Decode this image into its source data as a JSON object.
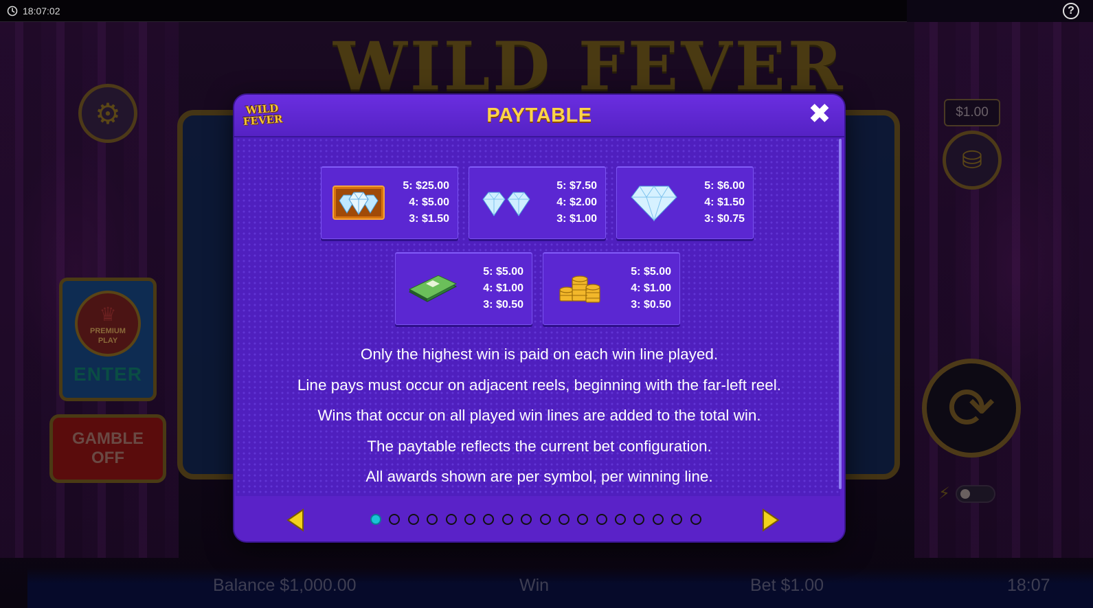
{
  "status_bar": {
    "time": "18:07:02",
    "help_icon": "question-circle-icon"
  },
  "background_game": {
    "logo": "WILD FEVER",
    "bet_display": "$1.00",
    "premium_play": {
      "line1": "PREMIUM",
      "line2": "PLAY",
      "enter_label": "ENTER"
    },
    "gamble": {
      "line1": "GAMBLE",
      "line2": "OFF"
    },
    "bottom_bar": {
      "balance": "Balance $1,000.00",
      "win": "Win",
      "bet": "Bet $1.00",
      "clock": "18:07"
    }
  },
  "paytable": {
    "logo_line1": "WILD",
    "logo_line2": "FEVER",
    "title": "PAYTABLE",
    "close_icon": "close-x-icon",
    "symbols": [
      {
        "name": "framed-triple-diamond",
        "icon": "framed-triple-diamond-icon",
        "pays": [
          {
            "k": "5:",
            "v": "$25.00"
          },
          {
            "k": "4:",
            "v": "$5.00"
          },
          {
            "k": "3:",
            "v": "$1.50"
          }
        ]
      },
      {
        "name": "double-diamond",
        "icon": "double-diamond-icon",
        "pays": [
          {
            "k": "5:",
            "v": "$7.50"
          },
          {
            "k": "4:",
            "v": "$2.00"
          },
          {
            "k": "3:",
            "v": "$1.00"
          }
        ]
      },
      {
        "name": "single-diamond",
        "icon": "diamond-icon",
        "pays": [
          {
            "k": "5:",
            "v": "$6.00"
          },
          {
            "k": "4:",
            "v": "$1.50"
          },
          {
            "k": "3:",
            "v": "$0.75"
          }
        ]
      },
      {
        "name": "cash-stack",
        "icon": "cash-stack-icon",
        "pays": [
          {
            "k": "5:",
            "v": "$5.00"
          },
          {
            "k": "4:",
            "v": "$1.00"
          },
          {
            "k": "3:",
            "v": "$0.50"
          }
        ]
      },
      {
        "name": "gold-coins",
        "icon": "gold-coins-icon",
        "pays": [
          {
            "k": "5:",
            "v": "$5.00"
          },
          {
            "k": "4:",
            "v": "$1.00"
          },
          {
            "k": "3:",
            "v": "$0.50"
          }
        ]
      }
    ],
    "rules": [
      "Only the highest win is paid on each win line played.",
      "Line pays must occur on adjacent reels, beginning with the far-left reel.",
      "Wins that occur on all played win lines are added to the total win.",
      "The paytable reflects the current bet configuration.",
      "All awards shown are per symbol, per winning line."
    ],
    "pagination": {
      "total_pages": 18,
      "current_page": 1,
      "prev_icon": "arrow-left-icon",
      "next_icon": "arrow-right-icon"
    }
  },
  "colors": {
    "modal": "#5a22c8",
    "title": "#fcd34a",
    "active_dot": "#19c4d6",
    "arrow": "#f2d21c"
  }
}
